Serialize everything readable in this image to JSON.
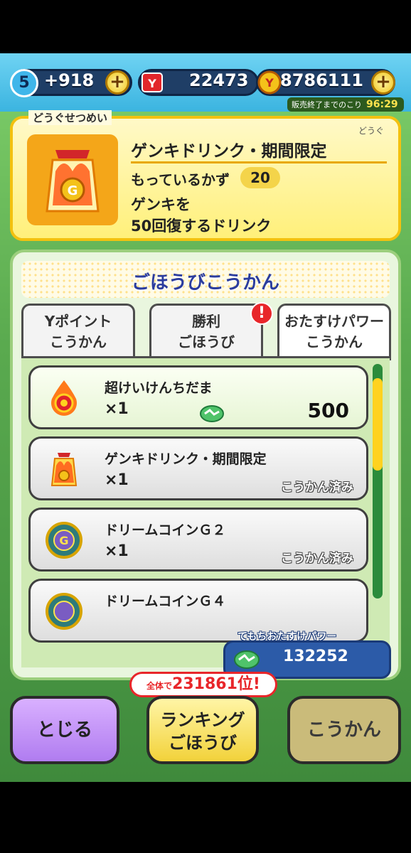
{
  "status": {
    "level": "5",
    "stamina": "+918",
    "tickets": "22473",
    "money": "8786111",
    "timer_label": "販売終了までのこり",
    "timer_value": "96:29"
  },
  "description": {
    "tag": "どうぐせつめい",
    "item_type": "どうぐ",
    "title": "ゲンキドリンク・期間限定",
    "owned_label": "もっているかず",
    "owned_count": "20",
    "body_line1": "ゲンキを",
    "body_line2": "50回復するドリンク"
  },
  "panel": {
    "title": "ごほうびこうかん",
    "tabs": [
      {
        "line1": "Yポイント",
        "line2": "こうかん"
      },
      {
        "line1": "勝利",
        "line2": "ごほうび"
      },
      {
        "line1": "おたすけパワー",
        "line2": "こうかん"
      }
    ],
    "alert": "!",
    "items": [
      {
        "name": "超けいけんちだま",
        "qty": "×1",
        "price": "500"
      },
      {
        "name": "ゲンキドリンク・期間限定",
        "qty": "×1",
        "status": "こうかん済み"
      },
      {
        "name": "ドリームコインＧ２",
        "qty": "×1",
        "status": "こうかん済み"
      },
      {
        "name": "ドリームコインＧ４"
      }
    ],
    "power_label": "てもちおたすけパワー",
    "power_value": "132252"
  },
  "buttons": {
    "close": "とじる",
    "ranking_line1": "ランキング",
    "ranking_line2": "ごほうび",
    "exchange": "こうかん",
    "rank_prefix": "全体で",
    "rank_value": "231861位!"
  },
  "colors": {
    "accent_yellow": "#f3c10f",
    "panel_green": "#9ccf7d",
    "title_blue": "#2b3d9e",
    "alert_red": "#e8262a"
  }
}
